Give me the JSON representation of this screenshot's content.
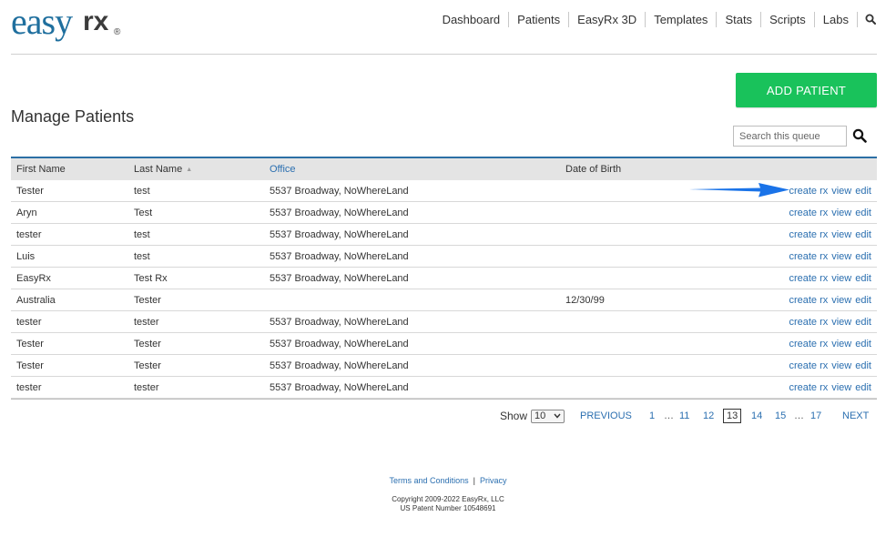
{
  "brand": {
    "logo_main": "easy",
    "logo_rx": "rx",
    "logo_reg": "®"
  },
  "nav": {
    "items": [
      "Dashboard",
      "Patients",
      "EasyRx 3D",
      "Templates",
      "Stats",
      "Scripts",
      "Labs"
    ],
    "search_icon": "search-icon"
  },
  "actions": {
    "add_patient": "ADD PATIENT"
  },
  "page": {
    "title": "Manage Patients"
  },
  "search": {
    "placeholder": "Search this queue"
  },
  "table": {
    "columns": [
      "First Name",
      "Last Name",
      "Office",
      "Date of Birth"
    ],
    "sort_indicator": "▲",
    "action_labels": {
      "create_rx": "create rx",
      "view": "view",
      "edit": "edit"
    },
    "rows": [
      {
        "first": "Tester",
        "last": "test",
        "office": "5537 Broadway, NoWhereLand",
        "dob": ""
      },
      {
        "first": "Aryn",
        "last": "Test",
        "office": "5537 Broadway, NoWhereLand",
        "dob": ""
      },
      {
        "first": "tester",
        "last": "test",
        "office": "5537 Broadway, NoWhereLand",
        "dob": ""
      },
      {
        "first": "Luis",
        "last": "test",
        "office": "5537 Broadway, NoWhereLand",
        "dob": ""
      },
      {
        "first": "EasyRx",
        "last": "Test Rx",
        "office": "5537 Broadway, NoWhereLand",
        "dob": ""
      },
      {
        "first": "Australia",
        "last": "Tester",
        "office": "",
        "dob": "12/30/99"
      },
      {
        "first": "tester",
        "last": "tester",
        "office": "5537 Broadway, NoWhereLand",
        "dob": ""
      },
      {
        "first": "Tester",
        "last": "Tester",
        "office": "5537 Broadway, NoWhereLand",
        "dob": ""
      },
      {
        "first": "Tester",
        "last": "Tester",
        "office": "5537 Broadway, NoWhereLand",
        "dob": ""
      },
      {
        "first": "tester",
        "last": "tester",
        "office": "5537 Broadway, NoWhereLand",
        "dob": ""
      }
    ]
  },
  "pagination": {
    "show_label": "Show",
    "page_size": "10",
    "previous": "PREVIOUS",
    "next": "NEXT",
    "pages": [
      "1",
      "…",
      "11",
      "12",
      "13",
      "14",
      "15",
      "…",
      "17"
    ],
    "current": "13"
  },
  "footer": {
    "terms": "Terms and Conditions",
    "separator": "|",
    "privacy": "Privacy",
    "copyright": "Copyright 2009-2022 EasyRx, LLC",
    "patent": "US Patent Number 10548691"
  },
  "colors": {
    "brand_blue": "#1f6f9e",
    "link_blue": "#2b6fb0",
    "add_green": "#19c25b",
    "annotation_arrow": "#1a73e8"
  }
}
